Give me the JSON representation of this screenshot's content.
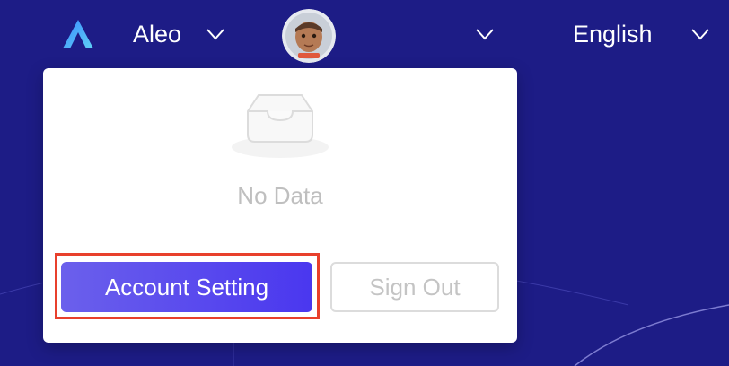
{
  "header": {
    "network": {
      "label": "Aleo",
      "icon": "chevron-down-icon"
    },
    "account": {
      "avatar": "astronaut-avatar",
      "icon": "chevron-down-icon"
    },
    "language": {
      "label": "English",
      "icon": "chevron-down-icon"
    }
  },
  "dropdown": {
    "empty_state": {
      "icon": "empty-inbox-icon",
      "text": "No Data"
    },
    "buttons": {
      "account_setting": "Account Setting",
      "sign_out": "Sign Out"
    }
  },
  "colors": {
    "background": "#1d1c86",
    "primary_start": "#6b60ec",
    "primary_end": "#4a37ef",
    "highlight_border": "#e8402c",
    "logo_start": "#3a8cff",
    "logo_end": "#5fd0f5"
  }
}
